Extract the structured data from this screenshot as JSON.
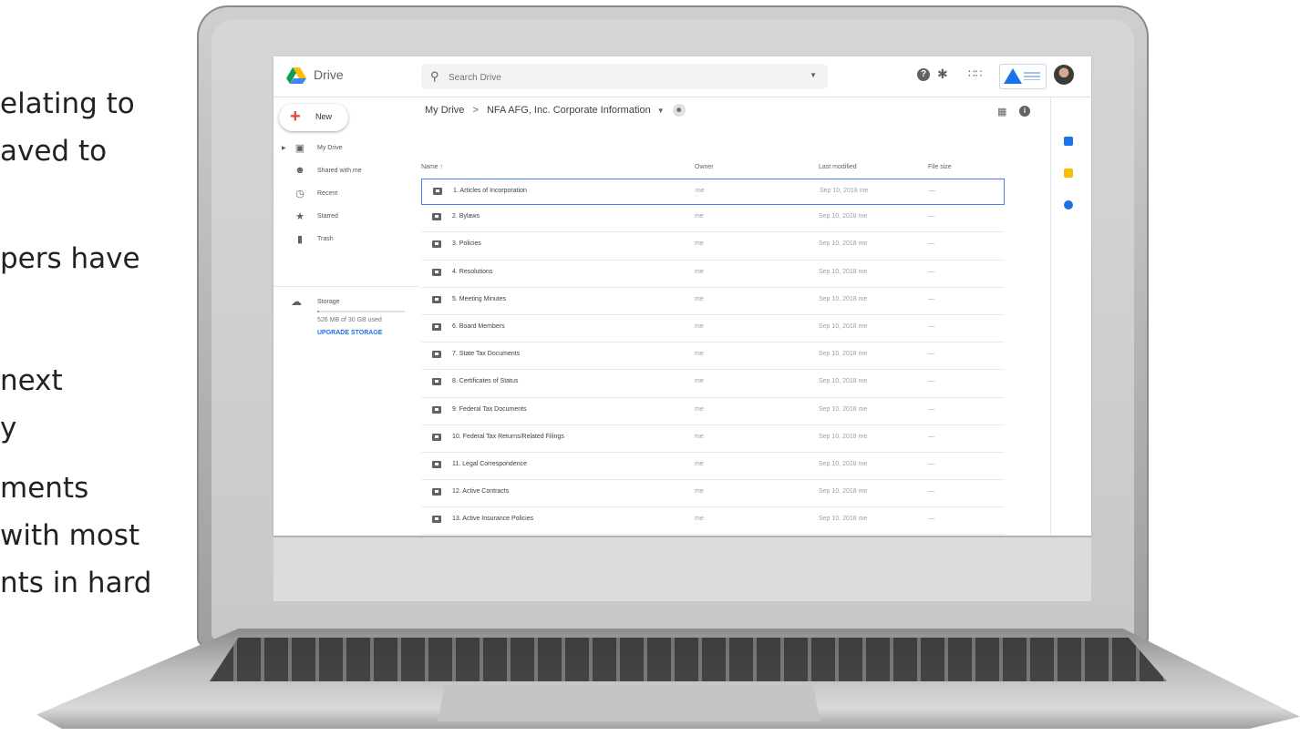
{
  "slide_text": [
    "elating to",
    "aved to",
    "pers have",
    "next",
    "y",
    "ments",
    "with most",
    "nts in hard"
  ],
  "colors": {
    "accent": "#1a73e8",
    "new_plus": "#ea4335",
    "selected_border": "#4a7ff0"
  },
  "header": {
    "app_name": "Drive",
    "search_placeholder": "Search Drive",
    "icons": [
      "search-icon",
      "help-icon",
      "gear-icon",
      "apps-grid-icon",
      "avatar"
    ]
  },
  "sidebar": {
    "new_label": "New",
    "items": [
      {
        "label": "My Drive",
        "icon": "my-drive-icon"
      },
      {
        "label": "Shared with me",
        "icon": "people-icon"
      },
      {
        "label": "Recent",
        "icon": "clock-icon"
      },
      {
        "label": "Starred",
        "icon": "star-icon"
      },
      {
        "label": "Trash",
        "icon": "trash-icon"
      }
    ],
    "storage_label": "Storage",
    "storage_used": "526 MB of 30 GB used",
    "storage_fraction": 0.02,
    "upgrade_label": "UPGRADE STORAGE"
  },
  "breadcrumb": {
    "root": "My Drive",
    "separator": ">",
    "current": "NFA AFG, Inc. Corporate Information"
  },
  "table": {
    "headers": {
      "name": "Name",
      "sort_arrow": "↑",
      "owner": "Owner",
      "modified": "Last modified",
      "size": "File size"
    },
    "rows": [
      {
        "name": "1. Articles of Incorporation",
        "owner": "me",
        "modified": "Sep 10, 2018 me",
        "size": "—"
      },
      {
        "name": "2. Bylaws",
        "owner": "me",
        "modified": "Sep 10, 2018 me",
        "size": "—"
      },
      {
        "name": "3. Policies",
        "owner": "me",
        "modified": "Sep 10, 2018 me",
        "size": "—"
      },
      {
        "name": "4. Resolutions",
        "owner": "me",
        "modified": "Sep 10, 2018 me",
        "size": "—"
      },
      {
        "name": "5. Meeting Minutes",
        "owner": "me",
        "modified": "Sep 10, 2018 me",
        "size": "—"
      },
      {
        "name": "6. Board Members",
        "owner": "me",
        "modified": "Sep 10, 2018 me",
        "size": "—"
      },
      {
        "name": "7. State Tax Documents",
        "owner": "me",
        "modified": "Sep 10, 2018 me",
        "size": "—"
      },
      {
        "name": "8. Certificates of Status",
        "owner": "me",
        "modified": "Sep 10, 2018 me",
        "size": "—"
      },
      {
        "name": "9. Federal Tax Documents",
        "owner": "me",
        "modified": "Sep 10, 2018 me",
        "size": "—"
      },
      {
        "name": "10. Federal Tax Returns/Related Filings",
        "owner": "me",
        "modified": "Sep 10, 2018 me",
        "size": "—"
      },
      {
        "name": "11. Legal Correspondence",
        "owner": "me",
        "modified": "Sep 10, 2018 me",
        "size": "—"
      },
      {
        "name": "12. Active Contracts",
        "owner": "me",
        "modified": "Sep 10, 2018 me",
        "size": "—"
      },
      {
        "name": "13. Active Insurance Policies",
        "owner": "me",
        "modified": "Sep 10, 2018 me",
        "size": "—"
      }
    ]
  }
}
